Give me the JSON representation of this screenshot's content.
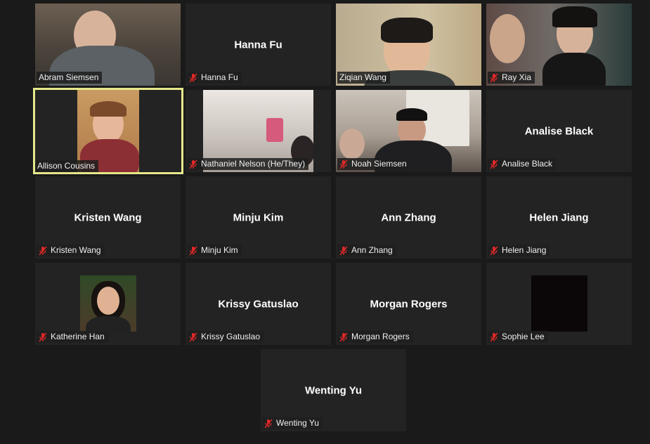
{
  "participants": [
    {
      "name": "Abram Siemsen",
      "video": true,
      "muted": false
    },
    {
      "name": "Hanna Fu",
      "video": false,
      "muted": true
    },
    {
      "name": "Ziqian Wang",
      "video": true,
      "muted": false
    },
    {
      "name": "Ray Xia",
      "video": true,
      "muted": true
    },
    {
      "name": "Allison Cousins",
      "video": true,
      "muted": false,
      "active_speaker": true
    },
    {
      "name": "Nathaniel Nelson (He/They)",
      "video": true,
      "muted": true
    },
    {
      "name": "Noah Siemsen",
      "video": true,
      "muted": true
    },
    {
      "name": "Analise Black",
      "video": false,
      "muted": true
    },
    {
      "name": "Kristen Wang",
      "video": false,
      "muted": true
    },
    {
      "name": "Minju Kim",
      "video": false,
      "muted": true
    },
    {
      "name": "Ann Zhang",
      "video": false,
      "muted": true
    },
    {
      "name": "Helen Jiang",
      "video": false,
      "muted": true
    },
    {
      "name": "Katherine Han",
      "video": true,
      "muted": true
    },
    {
      "name": "Krissy Gatuslao",
      "video": false,
      "muted": true
    },
    {
      "name": "Morgan Rogers",
      "video": false,
      "muted": true
    },
    {
      "name": "Sophie Lee",
      "video": true,
      "muted": true
    },
    {
      "name": "Wenting Yu",
      "video": false,
      "muted": true
    }
  ],
  "colors": {
    "background": "#1a1a1a",
    "tile": "#232323",
    "active_speaker_border": "#e6e889",
    "muted_icon": "#e02828"
  },
  "icons": {
    "muted": "mic-off-icon"
  }
}
